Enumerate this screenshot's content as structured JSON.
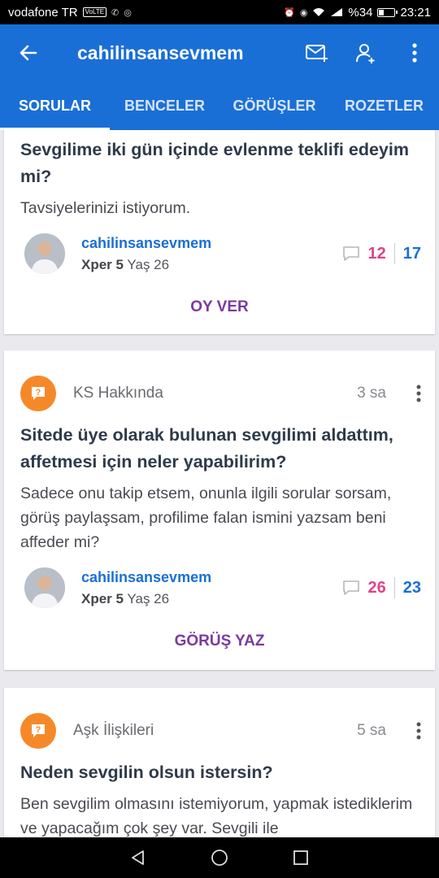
{
  "status": {
    "carrier": "vodafone TR",
    "volte": "VoLTE",
    "battery_text": "%34",
    "battery_level": 0.34,
    "time": "23:21"
  },
  "appbar": {
    "title": "cahilinsansevmem"
  },
  "tabs": [
    {
      "label": "SORULAR",
      "active": true
    },
    {
      "label": "BENCELER",
      "active": false
    },
    {
      "label": "GÖRÜŞLER",
      "active": false
    },
    {
      "label": "ROZETLER",
      "active": false
    }
  ],
  "colors": {
    "primary": "#1a6fd6",
    "category_badge": "#f5892a",
    "comment_count": "#e0428b",
    "action": "#7a3aa0"
  },
  "cards": [
    {
      "title": "Sevgilime iki gün içinde evlenme teklifi edeyim mi?",
      "body": "Tavsiyelerinizi istiyorum.",
      "author": "cahilinsansevmem",
      "author_level": "Xper 5",
      "author_age": "Yaş 26",
      "comments": "12",
      "votes": "17",
      "action": "OY VER"
    },
    {
      "category": "KS Hakkında",
      "time": "3 sa",
      "title": "Sitede üye olarak bulunan sevgilimi aldattım, affetmesi için neler yapabilirim?",
      "body": "Sadece onu takip etsem, onunla ilgili sorular sorsam, görüş paylaşsam, profilime falan ismini yazsam beni affeder mi?",
      "author": "cahilinsansevmem",
      "author_level": "Xper 5",
      "author_age": "Yaş 26",
      "comments": "26",
      "votes": "23",
      "action": "GÖRÜŞ YAZ"
    },
    {
      "category": "Aşk İlişkileri",
      "time": "5 sa",
      "title": "Neden sevgilin olsun istersin?",
      "body": "Ben sevgilim olmasını istemiyorum, yapmak istediklerim ve yapacağım çok şey var. Sevgili ile"
    }
  ]
}
